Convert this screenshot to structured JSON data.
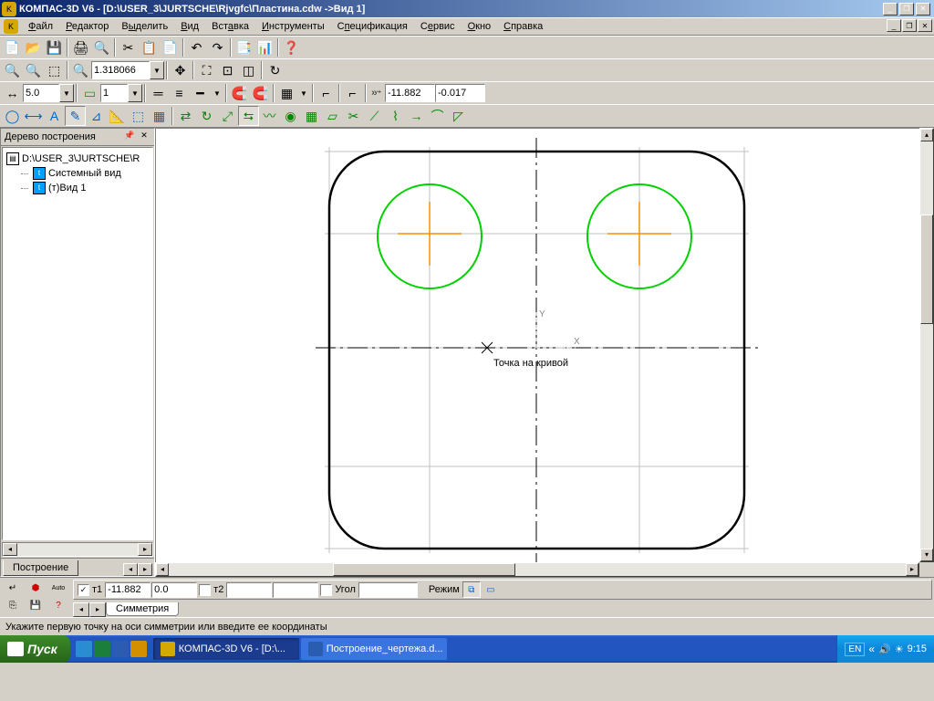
{
  "titlebar": {
    "title": "КОМПАС-3D V6 - [D:\\USER_3\\JURTSCHE\\Rjvgfc\\Пластина.cdw ->Вид 1]"
  },
  "menu": {
    "file": "Файл",
    "edit": "Редактор",
    "select": "Выделить",
    "view": "Вид",
    "insert": "Вставка",
    "tools": "Инструменты",
    "spec": "Спецификация",
    "service": "Сервис",
    "window": "Окно",
    "help": "Справка"
  },
  "toolbar2": {
    "zoom": "1.318066"
  },
  "toolbar3": {
    "step": "5.0",
    "layer": "1",
    "coordx": "-11.882",
    "coordy": "-0.017"
  },
  "side": {
    "title": "Дерево построения",
    "root": "D:\\USER_3\\JURTSCHE\\R",
    "item1": "Системный вид",
    "item2": "(т)Вид 1",
    "tab": "Построение"
  },
  "canvas": {
    "hint": "Точка на кривой",
    "axisY": "Y",
    "axisX": "X"
  },
  "props": {
    "t1_label": "т1",
    "t1x": "-11.882",
    "t1y": "0.0",
    "t2_label": "т2",
    "t2x": "",
    "t2y": "",
    "angle_label": "Угол",
    "angle": "",
    "mode_label": "Режим",
    "tab": "Симметрия"
  },
  "status": {
    "text": "Укажите первую точку на оси симметрии или введите ее координаты"
  },
  "taskbar": {
    "start": "Пуск",
    "task1": "КОМПАС-3D V6 - [D:\\...",
    "task2": "Построение_чертежа.d...",
    "lang": "EN",
    "time": "9:15"
  }
}
